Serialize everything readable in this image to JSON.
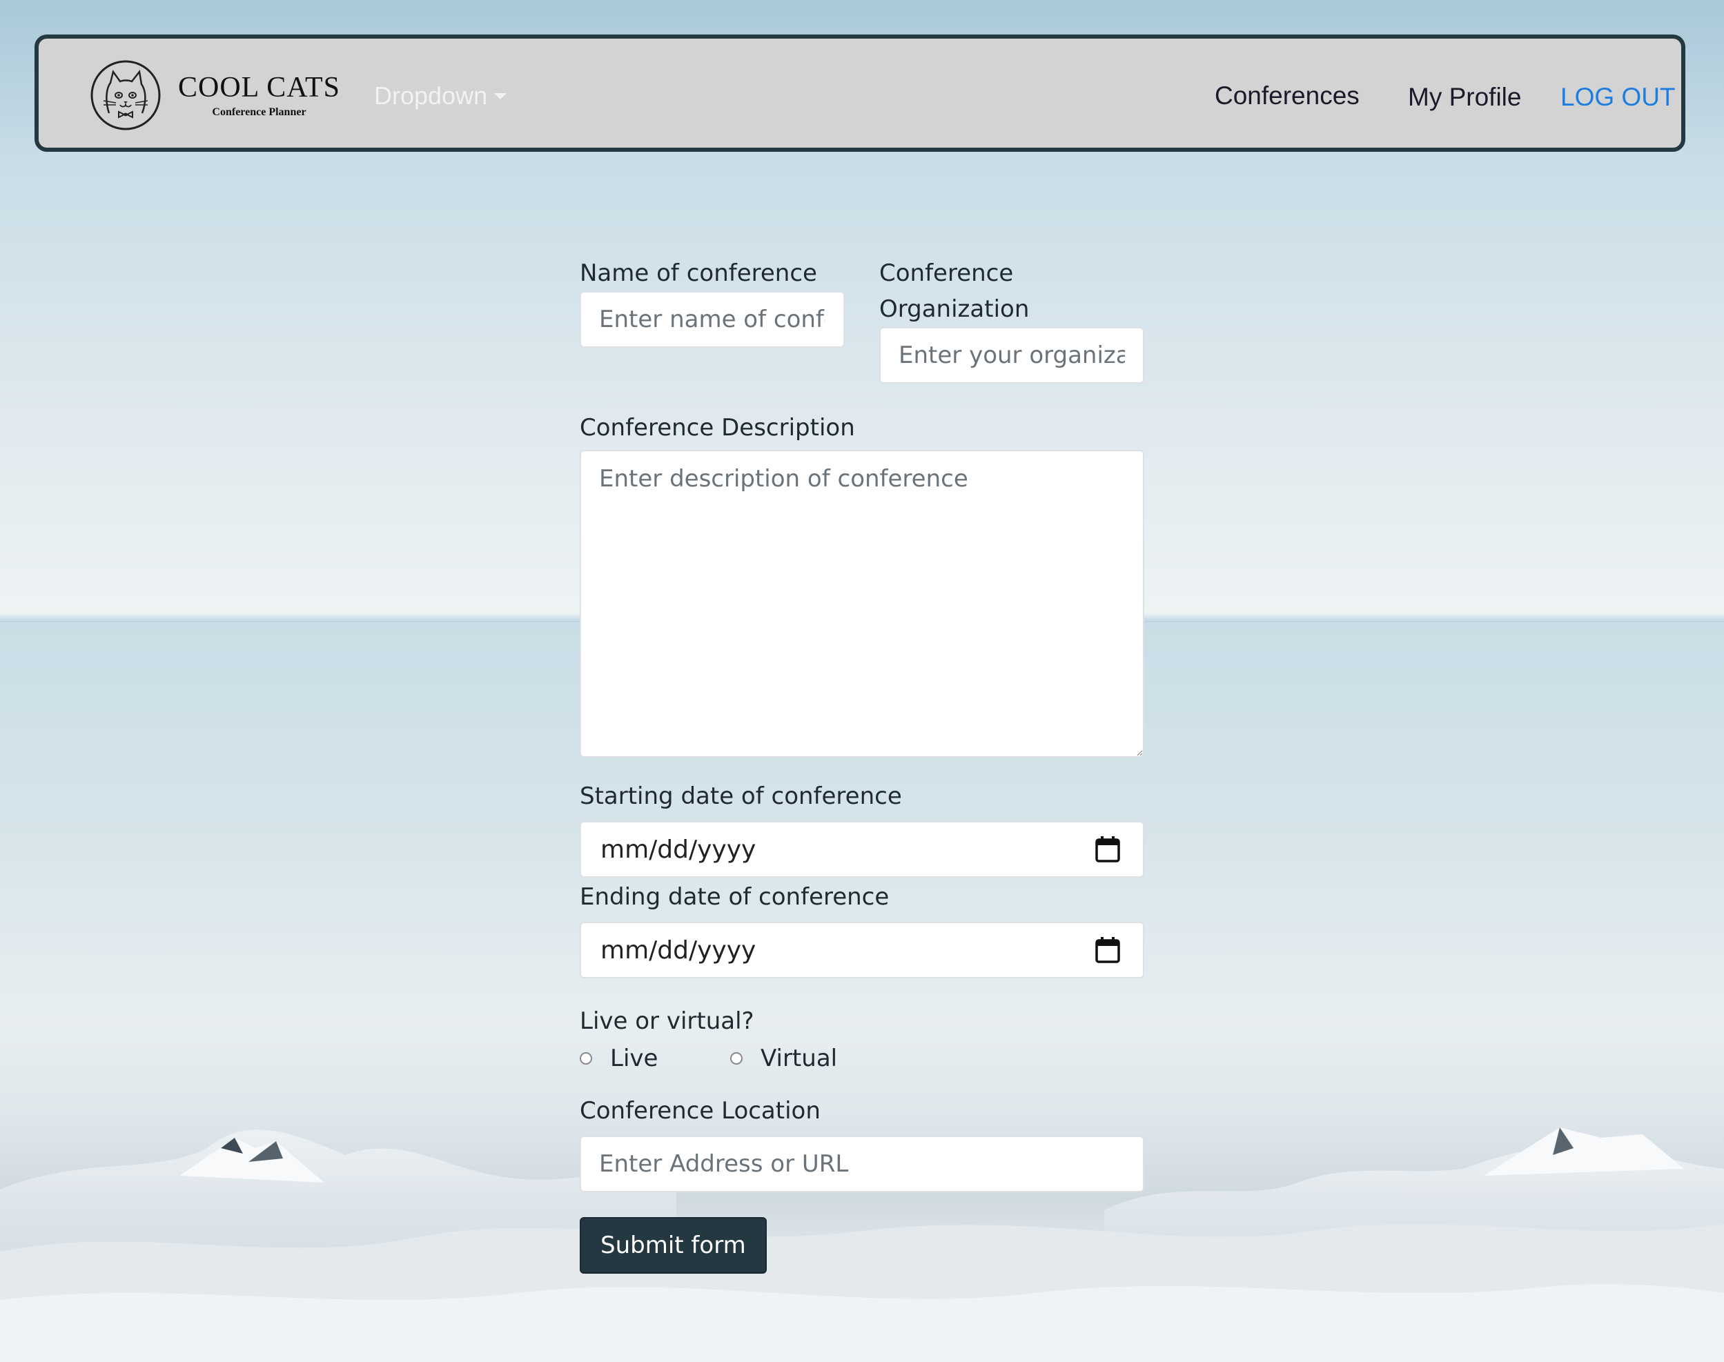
{
  "navbar": {
    "brand_title": "COOL CATS",
    "brand_subtitle": "Conference Planner",
    "dropdown_label": "Dropdown",
    "links": {
      "conferences": "Conferences",
      "profile": "My Profile",
      "logout": "LOG OUT"
    },
    "colors": {
      "background": "#d3d3d3",
      "border": "#233840",
      "logout": "#1e7ee0"
    }
  },
  "form": {
    "name": {
      "label": "Name of conference",
      "placeholder": "Enter name of conference"
    },
    "organization": {
      "label_line1": "Conference",
      "label_line2": "Organization",
      "placeholder": "Enter your organization"
    },
    "description": {
      "label": "Conference Description",
      "placeholder": "Enter description of conference"
    },
    "start_date": {
      "label": "Starting date of conference",
      "value": "mm/dd/yyyy"
    },
    "end_date": {
      "label": "Ending date of conference",
      "value": "mm/dd/yyyy"
    },
    "mode": {
      "label": "Live or virtual?",
      "options": [
        "Live",
        "Virtual"
      ]
    },
    "location": {
      "label": "Conference Location",
      "placeholder": "Enter Address or URL"
    },
    "submit_label": "Submit form",
    "colors": {
      "submit": "#233840"
    }
  },
  "icons": {
    "logo": "cat-face-icon",
    "calendar": "calendar-icon",
    "caret": "chevron-down-icon"
  }
}
